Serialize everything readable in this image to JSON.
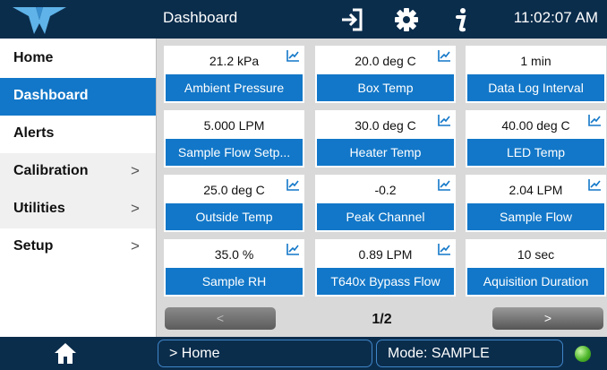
{
  "topbar": {
    "title": "Dashboard",
    "time": "11:02:07 AM",
    "icons": [
      "logo-icon",
      "sign-in-icon",
      "gear-icon",
      "info-icon"
    ]
  },
  "sidebar": {
    "items": [
      {
        "label": "Home",
        "has_submenu": false
      },
      {
        "label": "Dashboard",
        "has_submenu": false,
        "active": true
      },
      {
        "label": "Alerts",
        "has_submenu": false
      },
      {
        "label": "Calibration",
        "has_submenu": true
      },
      {
        "label": "Utilities",
        "has_submenu": true
      },
      {
        "label": "Setup",
        "has_submenu": true
      }
    ],
    "chevron": ">"
  },
  "tiles": [
    {
      "value": "21.2 kPa",
      "label": "Ambient Pressure",
      "trend": true
    },
    {
      "value": "20.0 deg C",
      "label": "Box Temp",
      "trend": true
    },
    {
      "value": "1 min",
      "label": "Data Log Interval",
      "trend": false
    },
    {
      "value": "5.000 LPM",
      "label": "Sample Flow Setp...",
      "trend": false
    },
    {
      "value": "30.0 deg C",
      "label": "Heater Temp",
      "trend": true
    },
    {
      "value": "40.00 deg C",
      "label": "LED Temp",
      "trend": true
    },
    {
      "value": "25.0 deg C",
      "label": "Outside Temp",
      "trend": true
    },
    {
      "value": "-0.2",
      "label": "Peak Channel",
      "trend": true
    },
    {
      "value": "2.04 LPM",
      "label": "Sample Flow",
      "trend": true
    },
    {
      "value": "35.0 %",
      "label": "Sample RH",
      "trend": true
    },
    {
      "value": "0.89 LPM",
      "label": "T640x Bypass Flow",
      "trend": true
    },
    {
      "value": "10 sec",
      "label": "Aquisition Duration",
      "trend": false
    }
  ],
  "pager": {
    "prev": "<",
    "page": "1/2",
    "next": ">"
  },
  "statusbar": {
    "breadcrumb": "> Home",
    "mode": "Mode: SAMPLE",
    "status_color": "#4cb52a"
  },
  "colors": {
    "navy": "#0b2d4c",
    "accent": "#1277c8"
  }
}
